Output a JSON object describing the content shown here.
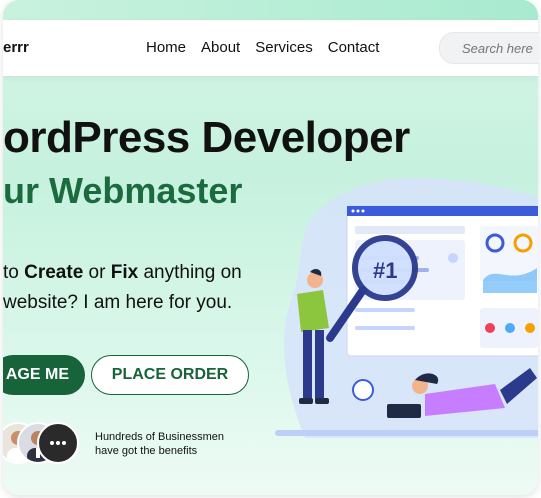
{
  "brand": {
    "logo_text": "errr"
  },
  "nav": {
    "items": [
      "Home",
      "About",
      "Services",
      "Contact"
    ],
    "search_placeholder": "Search here"
  },
  "hero": {
    "title_line1": "ordPress Developer",
    "title_line2": "ur Webmaster",
    "desc_prefix": "to ",
    "desc_create": "Create",
    "desc_or": " or ",
    "desc_fix": "Fix",
    "desc_rest": " anything on",
    "desc_line2": "website? I am here for you.",
    "cta_primary": "AGE ME",
    "cta_secondary": "PLACE ORDER",
    "clients_line1": "Hundreds of Businessmen",
    "clients_line2": "have got the benefits"
  },
  "illustration": {
    "badge": "#1"
  },
  "colors": {
    "accent": "#17633a",
    "accent_text": "#1c6b3f",
    "bg": "#c6f1de",
    "screen_blue": "#3b5bdb"
  }
}
